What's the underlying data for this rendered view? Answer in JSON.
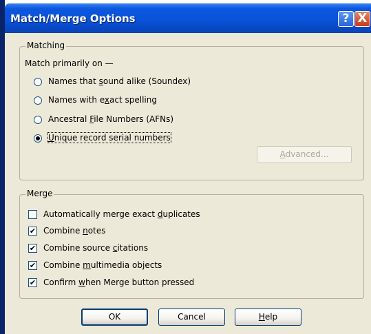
{
  "window": {
    "title": "Match/Merge Options",
    "help_glyph": "?",
    "close_glyph": "X"
  },
  "matching": {
    "group_label": "Matching",
    "prompt": "Match primarily on —",
    "options": [
      {
        "pre": "Names that ",
        "accel": "s",
        "post": "ound alike (Soundex)",
        "checked": false
      },
      {
        "pre": "Names with e",
        "accel": "x",
        "post": "act spelling",
        "checked": false
      },
      {
        "pre": "Ancestral ",
        "accel": "F",
        "post": "ile Numbers (AFNs)",
        "checked": false
      },
      {
        "pre": "",
        "accel": "U",
        "post": "nique record serial numbers",
        "checked": true
      }
    ],
    "advanced_pre": "",
    "advanced_accel": "A",
    "advanced_post": "dvanced..."
  },
  "merge": {
    "group_label": "Merge",
    "options": [
      {
        "pre": "Automatically merge exact ",
        "accel": "d",
        "post": "uplicates",
        "checked": false
      },
      {
        "pre": "Combine ",
        "accel": "n",
        "post": "otes",
        "checked": true
      },
      {
        "pre": "Combine source ",
        "accel": "c",
        "post": "itations",
        "checked": true
      },
      {
        "pre": "Combine ",
        "accel": "m",
        "post": "ultimedia objects",
        "checked": true
      },
      {
        "pre": "Confirm ",
        "accel": "w",
        "post": "hen Merge button pressed",
        "checked": true
      }
    ]
  },
  "buttons": {
    "ok": "OK",
    "cancel": "Cancel",
    "help_accel": "H",
    "help_post": "elp"
  },
  "colors": {
    "titlebar": "#0a53d8",
    "dialog_bg": "#ece9d8",
    "close_button": "#c63b1c"
  },
  "icons": {
    "check": "✔"
  }
}
